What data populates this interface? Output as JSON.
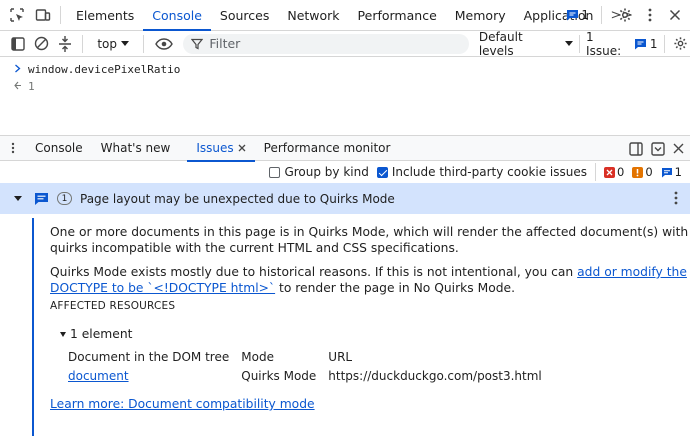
{
  "main_tabs": [
    {
      "label": "Elements",
      "active": false
    },
    {
      "label": "Console",
      "active": true
    },
    {
      "label": "Sources",
      "active": false
    },
    {
      "label": "Network",
      "active": false
    },
    {
      "label": "Performance",
      "active": false
    },
    {
      "label": "Memory",
      "active": false
    },
    {
      "label": "Application",
      "active": false
    }
  ],
  "more_tabs_label": ">>",
  "issue_badge_count": "1",
  "console_toolbar": {
    "context": "top",
    "filter_placeholder": "Filter",
    "levels": "Default levels",
    "issues_label": "1 Issue:",
    "issues_count": "1"
  },
  "console_lines": {
    "input": "window.devicePixelRatio",
    "result": "1"
  },
  "drawer_tabs": [
    {
      "label": "Console",
      "active": false
    },
    {
      "label": "What's new",
      "active": false
    },
    {
      "label": "Issues",
      "active": true
    },
    {
      "label": "Performance monitor",
      "active": false
    }
  ],
  "issues_toolbar": {
    "group_by_kind": "Group by kind",
    "third_party": "Include third-party cookie issues",
    "count_error": "0",
    "count_warning": "0",
    "count_info": "1"
  },
  "issue": {
    "count": "1",
    "title": "Page layout may be unexpected due to Quirks Mode",
    "para1": "One or more documents in this page is in Quirks Mode, which will render the affected document(s) with quirks incompatible with the current HTML and CSS specifications.",
    "para2_pre": "Quirks Mode exists mostly due to historical reasons. If this is not intentional, you can ",
    "para2_link": "add or modify the DOCTYPE to be `<!DOCTYPE html>`",
    "para2_post": " to render the page in No Quirks Mode.",
    "affected_label": "AFFECTED RESOURCES",
    "element_count": "1 element",
    "table_headers": [
      "Document in the DOM tree",
      "Mode",
      "URL"
    ],
    "table_row": [
      "document",
      "Quirks Mode",
      "https://duckduckgo.com/post3.html"
    ],
    "learn_more": "Learn more: Document compatibility mode"
  },
  "colors": {
    "accent": "#0b57d0",
    "issue_header_bg": "#d3e3fd",
    "error": "#d93025",
    "warning": "#e37400"
  }
}
